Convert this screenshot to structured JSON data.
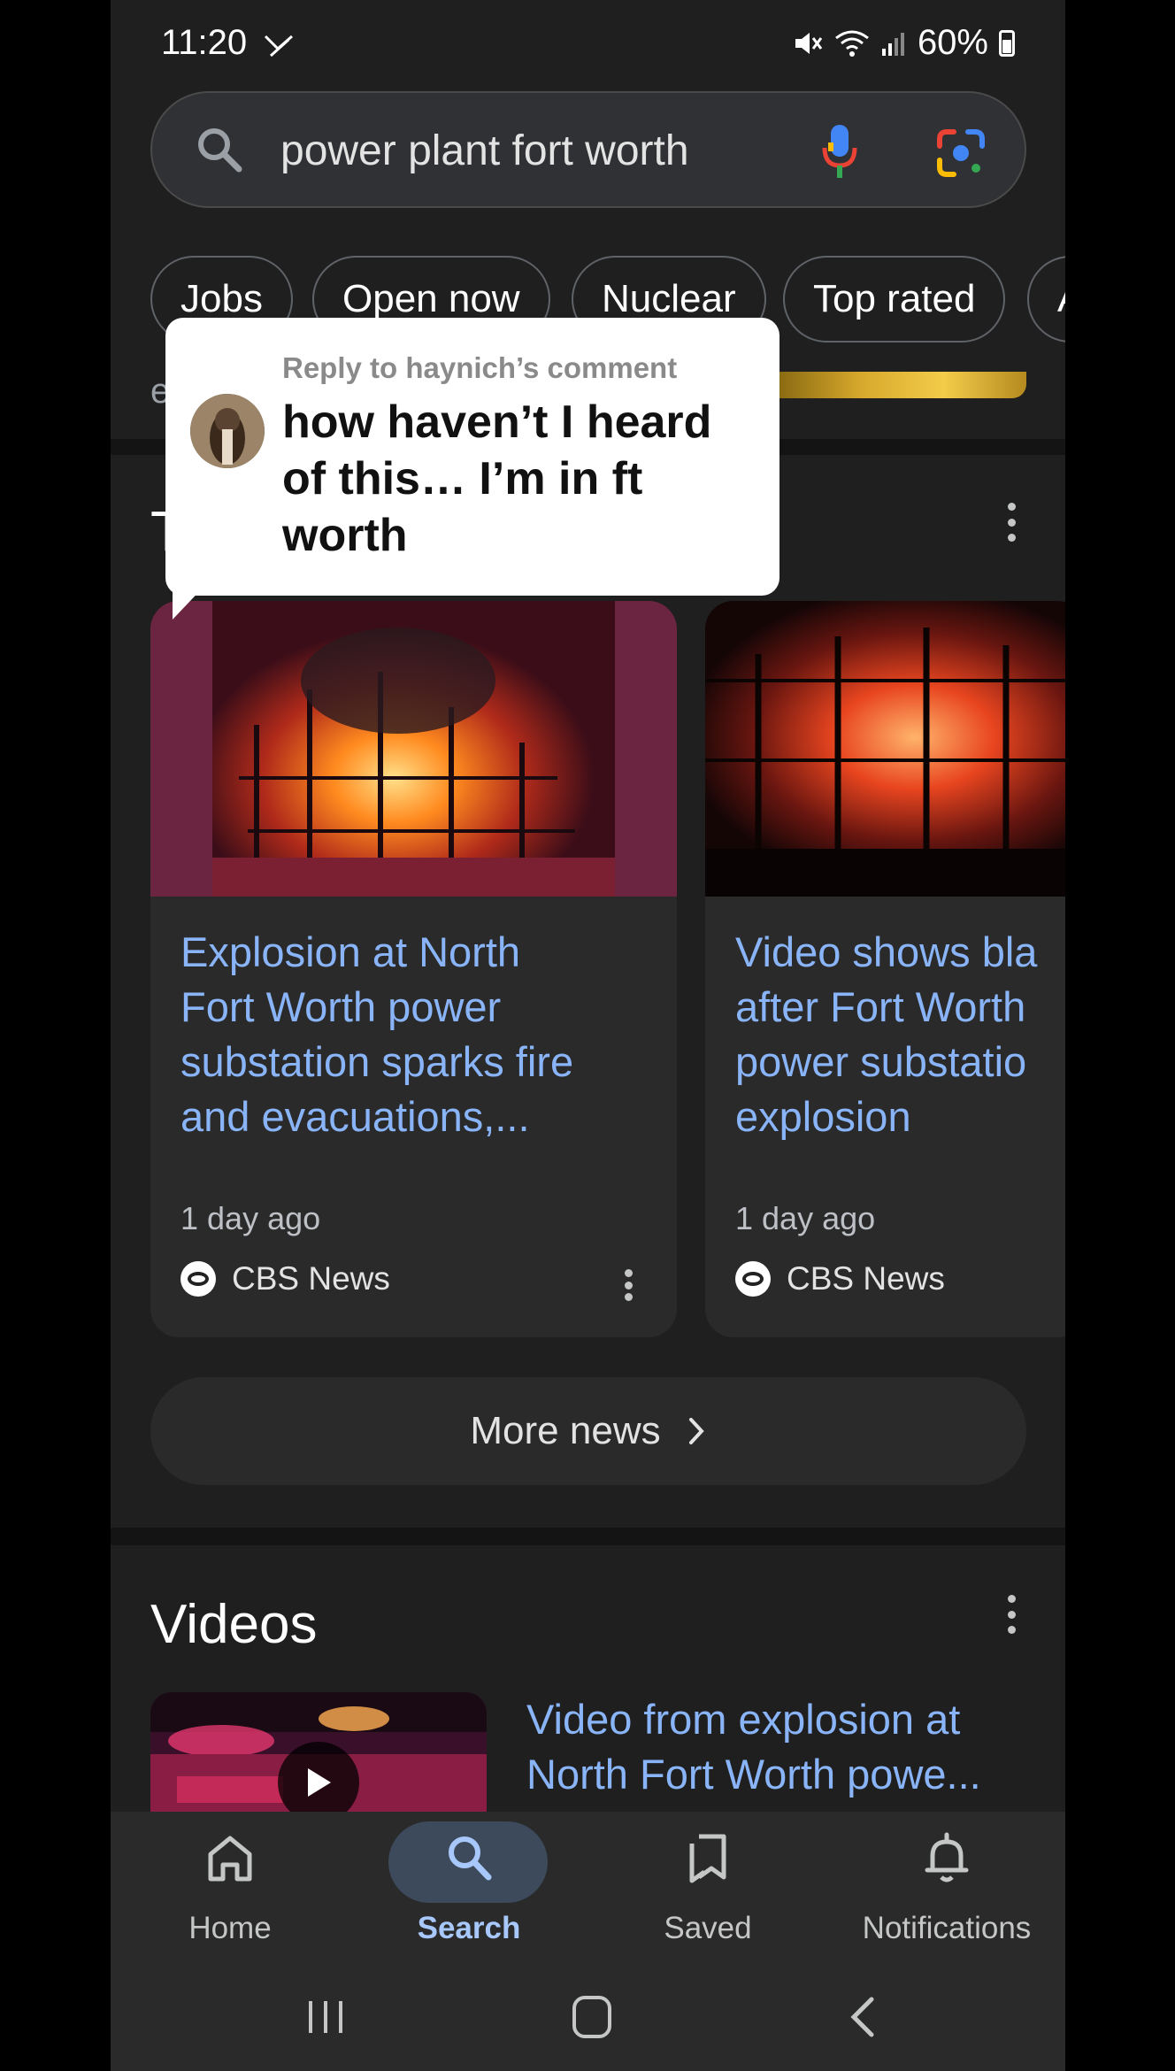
{
  "status_bar": {
    "time": "11:20",
    "battery": "60%"
  },
  "search": {
    "query": "power plant fort worth"
  },
  "chips": [
    {
      "label": "Jobs"
    },
    {
      "label": "Open now"
    },
    {
      "label": "Nuclear"
    },
    {
      "label": "Top rated"
    },
    {
      "label": "A"
    }
  ],
  "partial_text": "e",
  "top_stories": {
    "title_partial": "T",
    "cards": [
      {
        "title": "Explosion at North\nFort Worth power\nsubstation sparks fire\nand evacuations,...",
        "time": "1 day ago",
        "source": "CBS News"
      },
      {
        "title": "Video shows bla\nafter Fort Worth\npower substatio\nexplosion",
        "time": "1 day ago",
        "source": "CBS News"
      }
    ],
    "more_label": "More news"
  },
  "videos": {
    "title": "Videos",
    "items": [
      {
        "title": "Video from explosion at\nNorth Fort Worth powe..."
      }
    ]
  },
  "bottom_nav": {
    "active": "Search",
    "items": [
      {
        "label": "Home",
        "icon": "home-icon"
      },
      {
        "label": "Search",
        "icon": "search-icon"
      },
      {
        "label": "Saved",
        "icon": "saved-icon"
      },
      {
        "label": "Notifications",
        "icon": "bell-icon"
      }
    ]
  },
  "reply_overlay": {
    "label": "Reply to haynich’s comment",
    "text": "how haven’t I heard\nof this… I’m in ft\nworth"
  },
  "colors": {
    "accent_link": "#8ab4f8",
    "background": "#1f1f1f",
    "active_pill": "#3c4a5c"
  }
}
